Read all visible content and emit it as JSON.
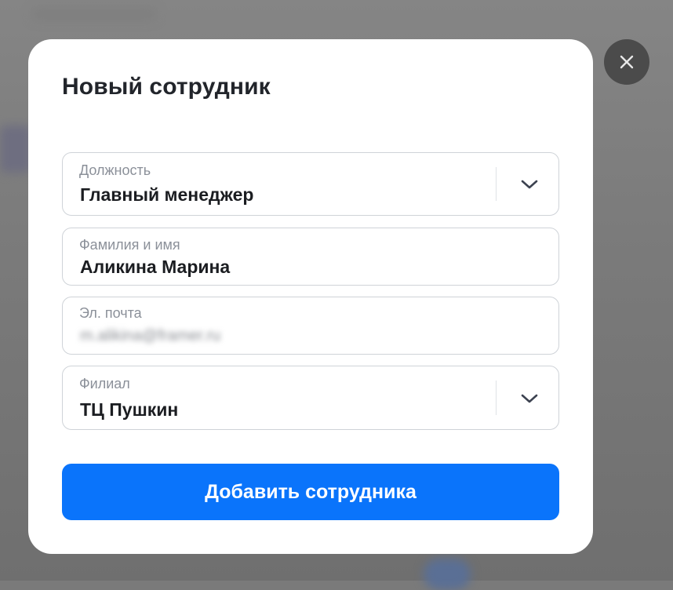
{
  "modal": {
    "title": "Новый сотрудник",
    "close_icon": "close-icon"
  },
  "fields": {
    "position": {
      "label": "Должность",
      "value": "Главный менеджер",
      "icon": "chevron-down-icon"
    },
    "name": {
      "label": "Фамилия и имя",
      "value": "Аликина Марина"
    },
    "email": {
      "label": "Эл. почта",
      "value": "m.alikina@framer.ru"
    },
    "branch": {
      "label": "Филиал",
      "value": "ТЦ Пушкин",
      "icon": "chevron-down-icon"
    }
  },
  "submit_label": "Добавить сотрудника",
  "colors": {
    "accent": "#0a74fb",
    "overlay": "#7a7a7a",
    "close_button": "#4b4b4b"
  }
}
